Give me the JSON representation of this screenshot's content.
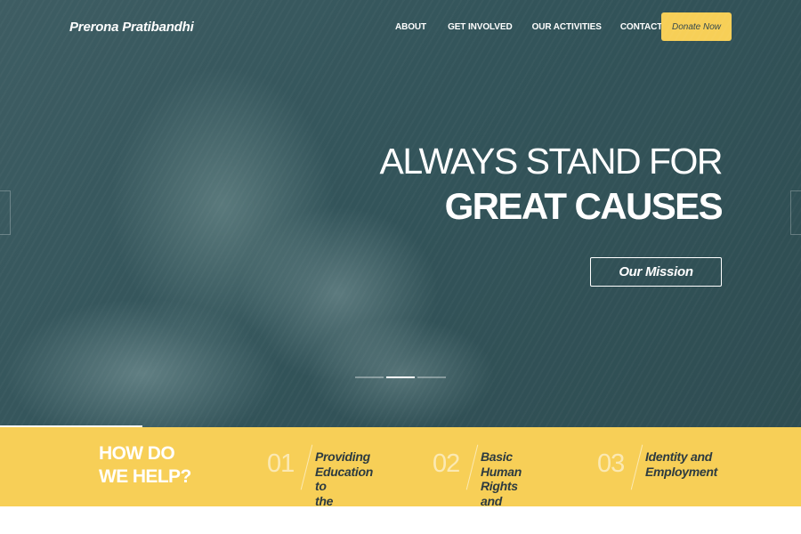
{
  "site": {
    "logo": "Prerona Pratibandhi"
  },
  "nav": {
    "items": [
      "ABOUT",
      "GET INVOLVED",
      "OUR ACTIVITIES",
      "CONTACT"
    ],
    "donate_label": "Donate Now"
  },
  "hero": {
    "headline_line1": "ALWAYS STAND FOR",
    "headline_line2": "GREAT CAUSES",
    "cta_label": "Our Mission",
    "slider": {
      "slide_count": 3,
      "active_slide": 2
    }
  },
  "help": {
    "title": "HOW DO\nWE HELP?",
    "items": [
      {
        "number": "01",
        "text": "Providing\nEducation to\nthe Disabled"
      },
      {
        "number": "02",
        "text": "Basic Human\nRights and\nFacilities"
      },
      {
        "number": "03",
        "text": "Identity and\nEmployment"
      }
    ]
  },
  "colors": {
    "accent_yellow": "#f7cf57",
    "hero_teal": "#33545a",
    "dark_text": "#2d3b40",
    "white": "#ffffff"
  }
}
